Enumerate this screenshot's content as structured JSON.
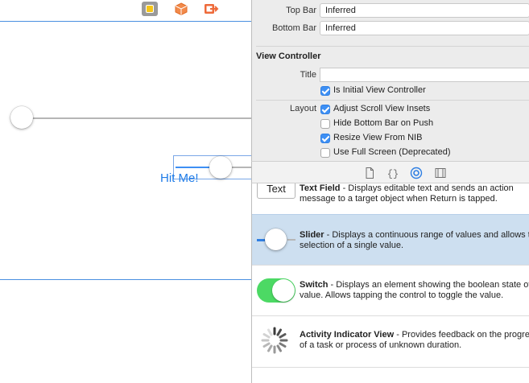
{
  "canvas": {
    "button_label": "Hit Me!",
    "toolbar": [
      {
        "name": "view-controller-icon"
      },
      {
        "name": "first-responder-icon"
      },
      {
        "name": "exit-icon"
      }
    ]
  },
  "inspector": {
    "top_bar": {
      "label": "Top Bar",
      "value": "Inferred"
    },
    "bottom_bar": {
      "label": "Bottom Bar",
      "value": "Inferred"
    },
    "section_title": "View Controller",
    "title_label": "Title",
    "title_value": "",
    "initial_vc": {
      "label": "Is Initial View Controller",
      "checked": true
    },
    "layout_label": "Layout",
    "layout_options": [
      {
        "label": "Adjust Scroll View Insets",
        "checked": true
      },
      {
        "label": "Hide Bottom Bar on Push",
        "checked": false
      },
      {
        "label": "Resize View From NIB",
        "checked": true
      },
      {
        "label": "Use Full Screen (Deprecated)",
        "checked": false
      }
    ]
  },
  "library_tabs": [
    {
      "name": "file-template-icon"
    },
    {
      "name": "code-snippet-icon"
    },
    {
      "name": "object-library-icon",
      "active": true
    },
    {
      "name": "media-library-icon"
    }
  ],
  "library": {
    "text_field": {
      "icon_text": "Text",
      "title": "Text Field",
      "desc": " - Displays editable text and sends an action message to a target object when Return is tapped."
    },
    "slider": {
      "title": "Slider",
      "desc": " - Displays a continuous range of values and allows the selection of a single value."
    },
    "switch": {
      "title": "Switch",
      "desc": " - Displays an element showing the boolean state of a value. Allows tapping the control to toggle the value."
    },
    "activity": {
      "title": "Activity Indicator View",
      "desc": " - Provides feedback on the progress of a task or process of unknown duration."
    }
  },
  "colors": {
    "accent": "#3d8ff4",
    "selection": "#cddff0",
    "switch_on": "#4cd964",
    "button_text": "#1f7ce8"
  }
}
